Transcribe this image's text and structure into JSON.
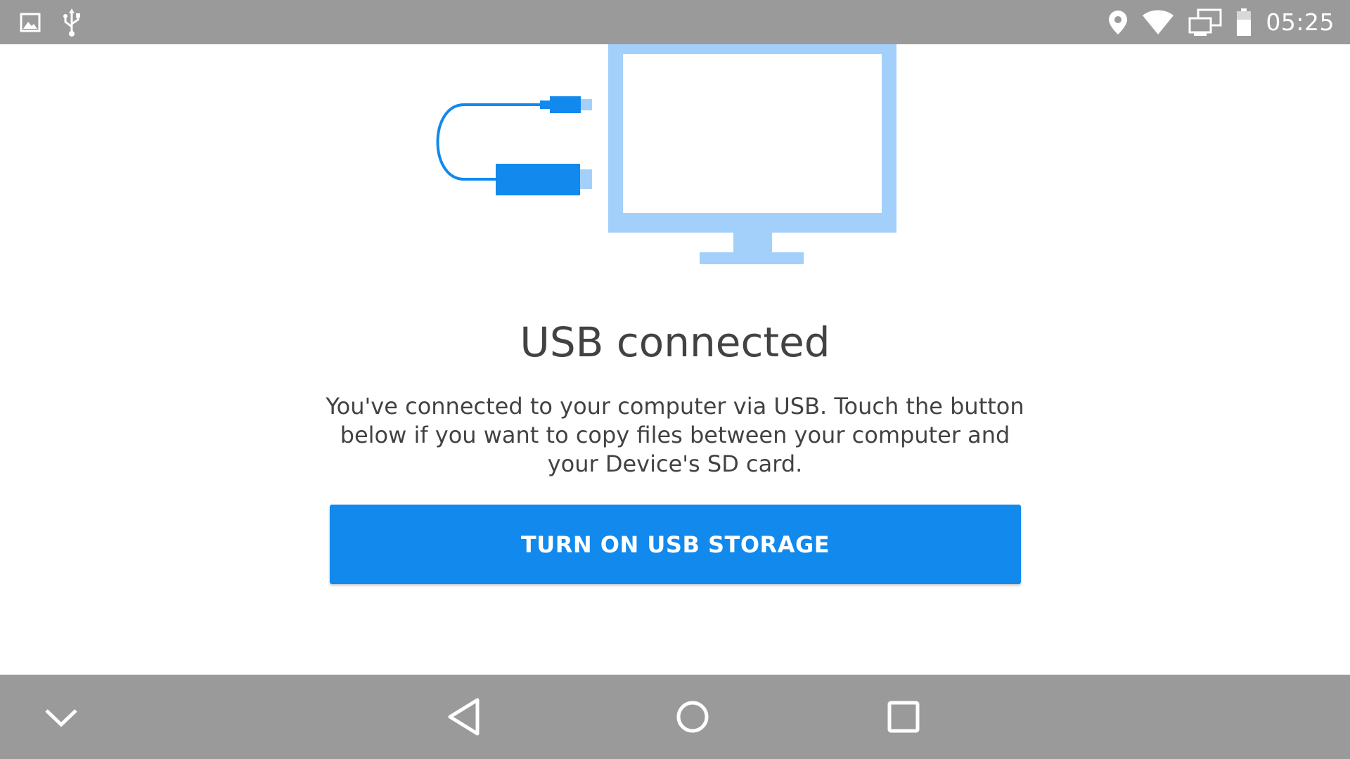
{
  "status_bar": {
    "time": "05:25",
    "left_icons": [
      "image-notification-icon",
      "usb-icon"
    ],
    "right_icons": [
      "location-icon",
      "wifi-icon",
      "cast-screen-icon",
      "battery-icon"
    ]
  },
  "main": {
    "title": "USB connected",
    "description": "You've connected to your computer via USB. Touch the button below if you want to copy files between your computer and your Device's SD card.",
    "button_label": "TURN ON USB STORAGE"
  },
  "navigation": {
    "buttons": [
      "collapse-icon",
      "back-icon",
      "home-icon",
      "recents-icon"
    ]
  },
  "colors": {
    "status_bar": "#9a9a9a",
    "accent_blue": "#1289ed",
    "monitor_blue": "#a3d0fb",
    "text": "#424242"
  }
}
